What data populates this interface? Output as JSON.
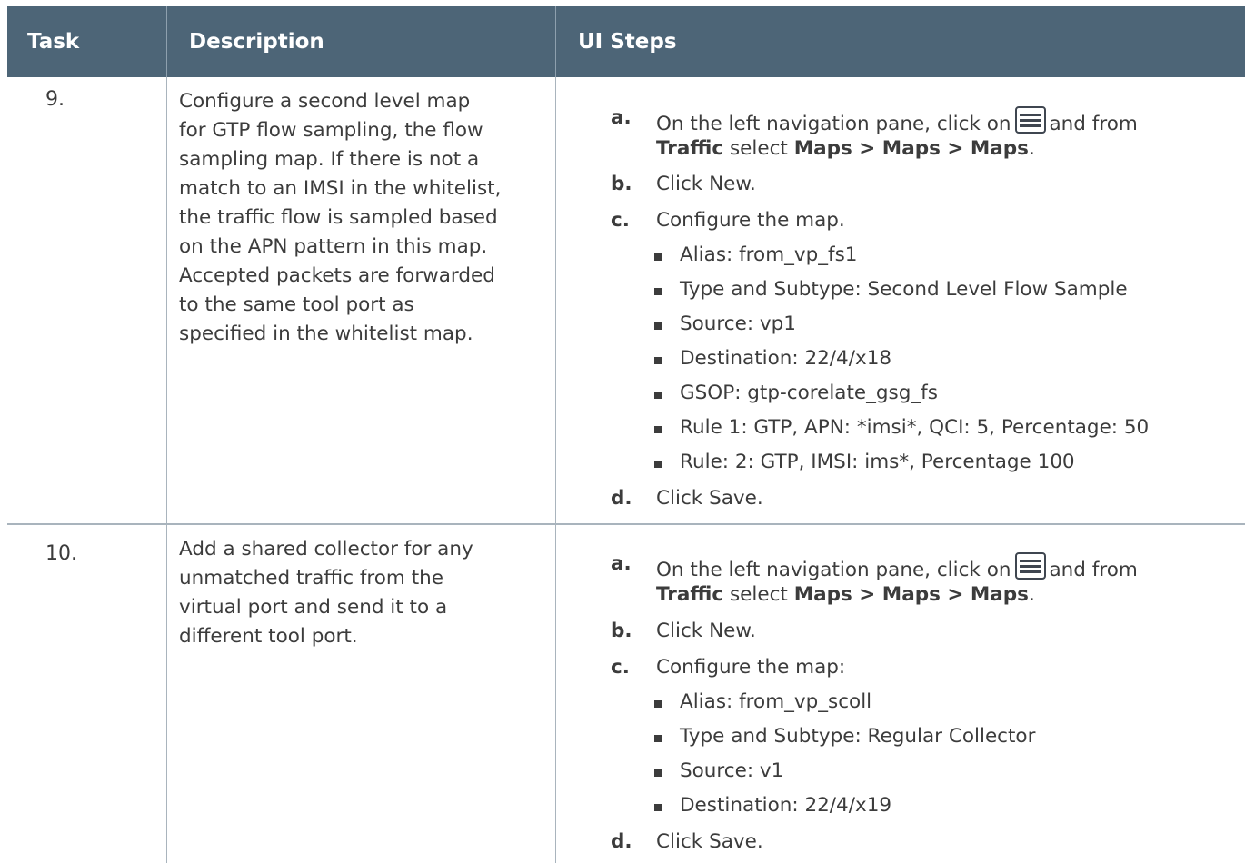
{
  "header": {
    "task": "Task",
    "description": "Description",
    "ui_steps": "UI Steps"
  },
  "rows": [
    {
      "task": "9.",
      "description_lines": [
        "Configure a second level map",
        "for GTP flow sampling, the flow",
        "sampling map. If there is not a",
        "match to an IMSI in the whitelist,",
        "the traffic flow is sampled based",
        "on the APN pattern in this map.",
        "Accepted packets are forwarded",
        "to the same tool port as",
        "specified in the whitelist map."
      ],
      "steps": {
        "a_letter": "a.",
        "a_pre": "On the left navigation pane, click on",
        "a_post": "and from",
        "a_traffic": "Traffic",
        "a_select": "select",
        "a_path": "Maps > Maps > Maps",
        "a_period": ".",
        "b_letter": "b.",
        "b_text": "Click New.",
        "c_letter": "c.",
        "c_text": "Configure the map.",
        "sub": [
          "Alias: from_vp_fs1",
          "Type and Subtype: Second Level Flow Sample",
          "Source: vp1",
          "Destination: 22/4/x18",
          "GSOP: gtp-corelate_gsg_fs",
          "Rule 1: GTP, APN: *imsi*, QCI: 5, Percentage: 50",
          "Rule: 2: GTP, IMSI: ims*, Percentage 100"
        ],
        "d_letter": "d.",
        "d_text": "Click Save."
      }
    },
    {
      "task": "10.",
      "description_lines": [
        "Add a shared collector for any",
        "unmatched traffic from the",
        "virtual port and send it to a",
        "different tool port."
      ],
      "steps": {
        "a_letter": "a.",
        "a_pre": "On the left navigation pane, click on",
        "a_post": "and from",
        "a_traffic": "Traffic",
        "a_select": "select",
        "a_path": "Maps > Maps > Maps",
        "a_period": ".",
        "b_letter": "b.",
        "b_text": "Click New.",
        "c_letter": "c.",
        "c_text": "Configure the map:",
        "sub": [
          "Alias: from_vp_scoll",
          "Type and Subtype: Regular Collector",
          "Source: v1",
          "Destination: 22/4/x19"
        ],
        "d_letter": "d.",
        "d_text": "Click Save."
      }
    }
  ],
  "icons": {
    "nav_icon": "traffic-nav-menu-icon"
  }
}
